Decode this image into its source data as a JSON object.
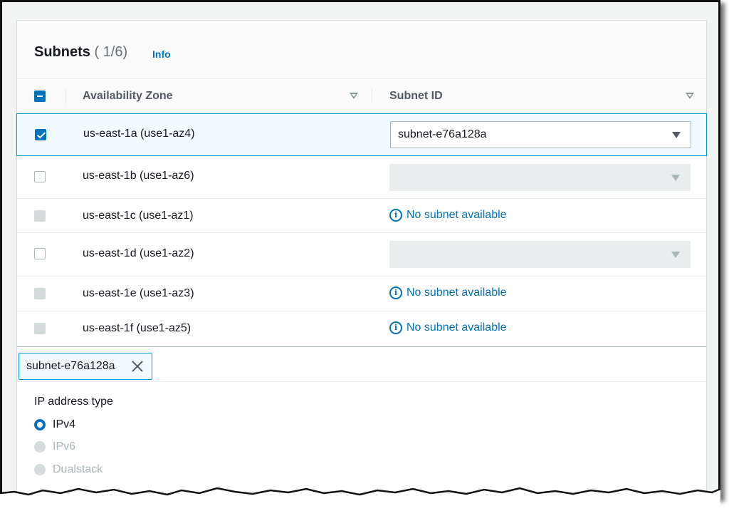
{
  "section": {
    "title": "Subnets",
    "count": "( 1/6)",
    "info_link": "Info"
  },
  "table": {
    "columns": [
      {
        "label": "Availability Zone",
        "sortable": true
      },
      {
        "label": "Subnet ID",
        "sortable": true
      }
    ],
    "header_checkbox_state": "indeterminate",
    "rows": [
      {
        "az": "us-east-1a (use1-az4)",
        "checkbox": "checked",
        "subnet_state": "select",
        "subnet_value": "subnet-e76a128a",
        "selected": true
      },
      {
        "az": "us-east-1b (use1-az6)",
        "checkbox": "unchecked",
        "subnet_state": "disabled-select",
        "subnet_value": ""
      },
      {
        "az": "us-east-1c (use1-az1)",
        "checkbox": "disabled",
        "subnet_state": "none",
        "subnet_value": "No subnet available"
      },
      {
        "az": "us-east-1d (use1-az2)",
        "checkbox": "unchecked",
        "subnet_state": "disabled-select",
        "subnet_value": ""
      },
      {
        "az": "us-east-1e (use1-az3)",
        "checkbox": "disabled",
        "subnet_state": "none",
        "subnet_value": "No subnet available"
      },
      {
        "az": "us-east-1f (use1-az5)",
        "checkbox": "disabled",
        "subnet_state": "none",
        "subnet_value": "No subnet available"
      }
    ]
  },
  "tokens": [
    {
      "label": "subnet-e76a128a",
      "icon": "close-icon"
    }
  ],
  "ip_address_type": {
    "label": "IP address type",
    "options": [
      {
        "label": "IPv4",
        "selected": true,
        "disabled": false
      },
      {
        "label": "IPv6",
        "selected": false,
        "disabled": true
      },
      {
        "label": "Dualstack",
        "selected": false,
        "disabled": true
      }
    ]
  },
  "icons": {
    "info": "info-circle-icon",
    "caret": "caret-down-icon",
    "sort": "sort-triangle-icon"
  },
  "colors": {
    "accent": "#0073bb",
    "selected_row_bg": "#f1faff",
    "selected_row_border": "#00a1c9",
    "disabled": "#d5dbdb"
  }
}
